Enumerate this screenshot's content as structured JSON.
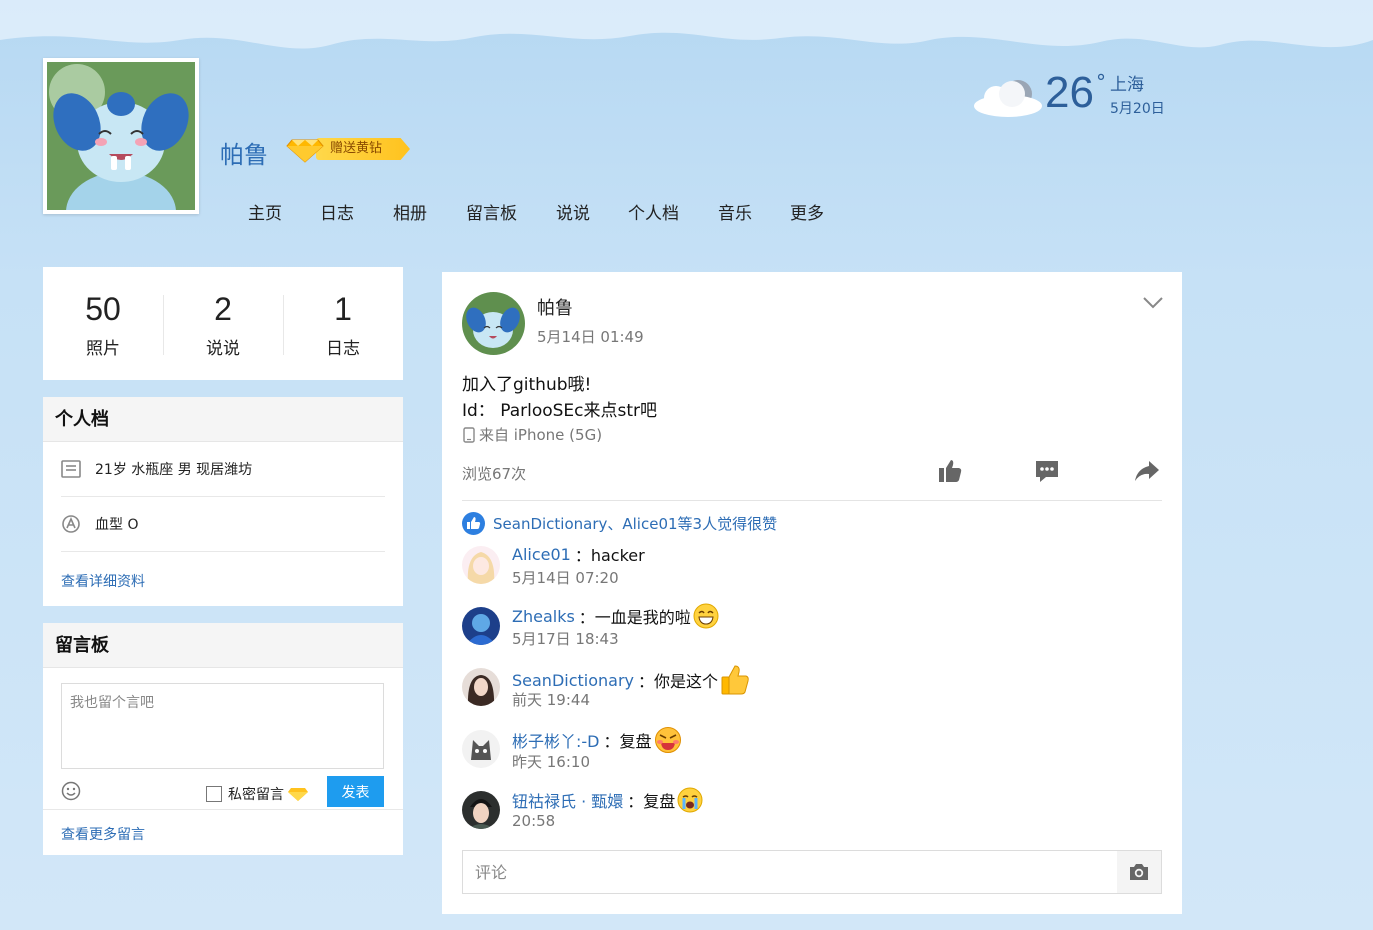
{
  "header": {
    "user_name": "帕鲁",
    "vip_label": "赠送黄钻",
    "nav": [
      "主页",
      "日志",
      "相册",
      "留言板",
      "说说",
      "个人档",
      "音乐",
      "更多"
    ]
  },
  "weather": {
    "temp": "26",
    "deg": "°",
    "city": "上海",
    "date": "5月20日"
  },
  "stats": [
    {
      "num": "50",
      "label": "照片"
    },
    {
      "num": "2",
      "label": "说说"
    },
    {
      "num": "1",
      "label": "日志"
    }
  ],
  "profile": {
    "title": "个人档",
    "info": "21岁  水瓶座 男 现居潍坊",
    "blood": "血型 O",
    "more": "查看详细资料"
  },
  "guestbook": {
    "title": "留言板",
    "placeholder": "我也留个言吧",
    "private_label": "私密留言",
    "send_label": "发表",
    "more": "查看更多留言"
  },
  "post": {
    "author": "帕鲁",
    "time": "5月14日 01:49",
    "line1": "加入了github哦!",
    "line2": "Id：  ParlooSEc来点str吧",
    "device": "来自 iPhone (5G)",
    "views": "浏览67次",
    "likes": "SeanDictionary、Alice01等3人觉得很赞",
    "comments": [
      {
        "user": "Alice01",
        "text": "：hacker",
        "time": "5月14日 07:20",
        "emoji": ""
      },
      {
        "user": "Zhealks",
        "text": "：一血是我的啦",
        "time": "5月17日 18:43",
        "emoji": "grin"
      },
      {
        "user": "SeanDictionary",
        "text": "：你是这个",
        "time": "前天 19:44",
        "emoji": "thumb"
      },
      {
        "user": "彬子彬丫:-D",
        "text": "：复盘",
        "time": "昨天 16:10",
        "emoji": "angry"
      },
      {
        "user": "钮祜禄氏 · 甄嬛",
        "text": "：复盘",
        "time": "20:58",
        "emoji": "cry"
      }
    ],
    "comment_placeholder": "评论"
  },
  "colors": {
    "link": "#2d6db5",
    "send_button": "#1e9cef",
    "vip_gold": "#ffc21e"
  }
}
